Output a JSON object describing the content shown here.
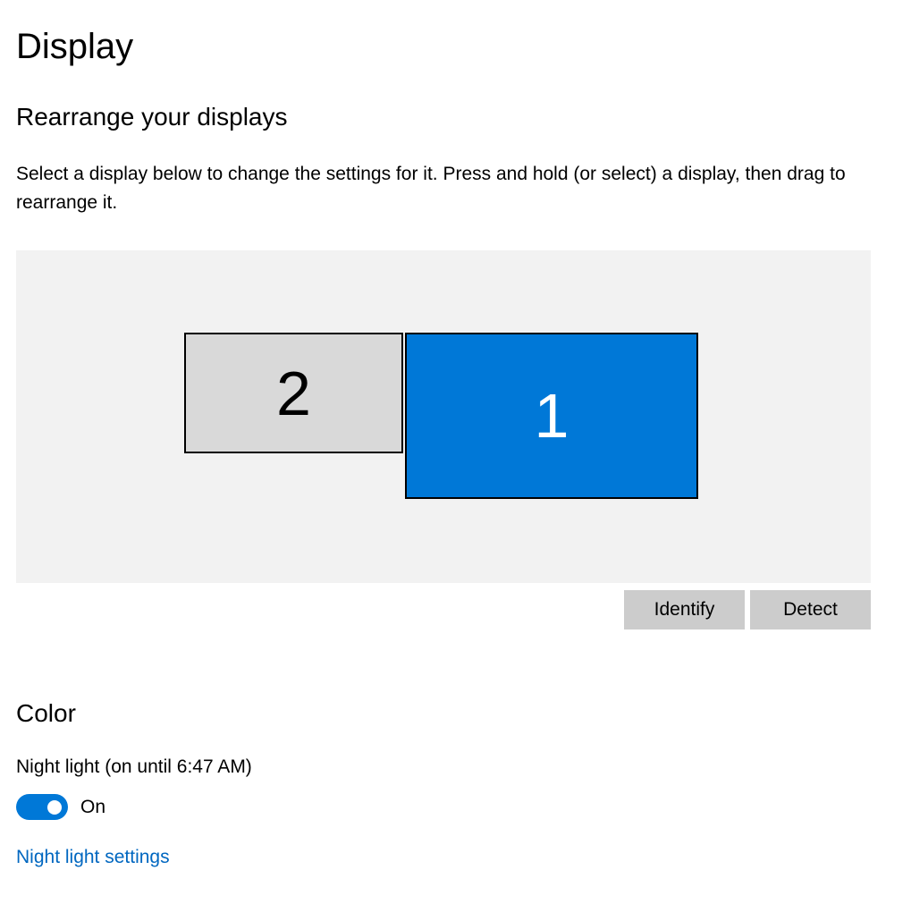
{
  "page_title": "Display",
  "rearrange": {
    "heading": "Rearrange your displays",
    "description": "Select a display below to change the settings for it. Press and hold (or select) a display, then drag to rearrange it.",
    "displays": [
      {
        "number": "2",
        "selected": false
      },
      {
        "number": "1",
        "selected": true
      }
    ],
    "identify_label": "Identify",
    "detect_label": "Detect"
  },
  "color": {
    "heading": "Color",
    "night_light_label": "Night light (on until 6:47 AM)",
    "toggle_state": "On",
    "toggle_on": true,
    "settings_link": "Night light settings"
  },
  "colors": {
    "accent": "#0078d7",
    "canvas_bg": "#f2f2f2",
    "button_bg": "#cccccc",
    "unselected_display": "#d9d9d9",
    "link": "#0067c0"
  }
}
